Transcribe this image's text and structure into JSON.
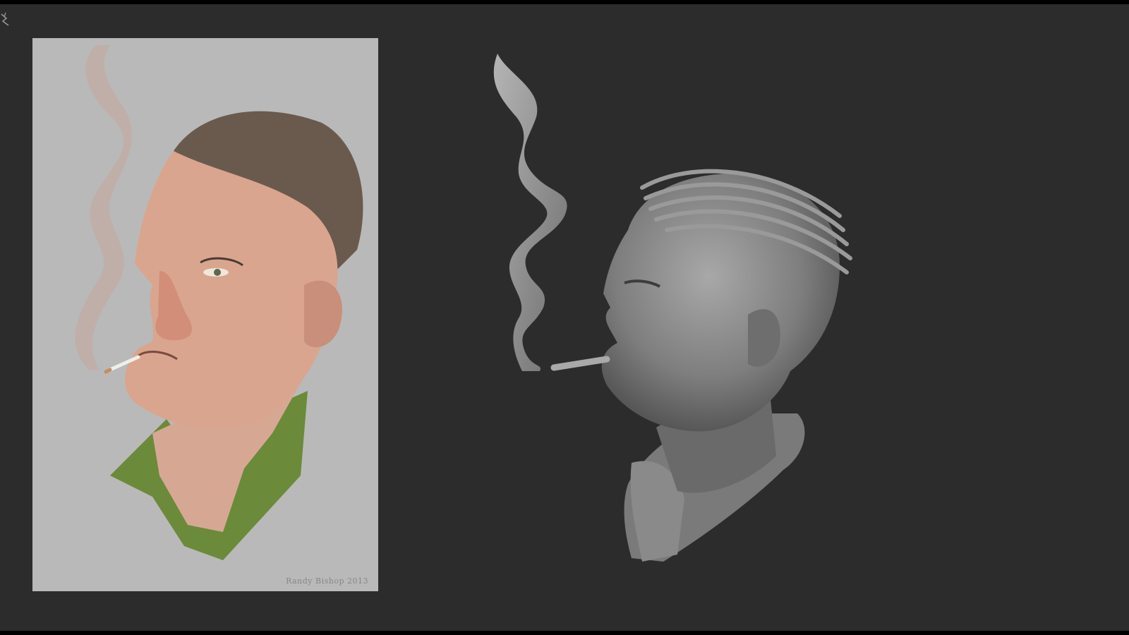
{
  "reference_image": {
    "signature": "Randy Bishop 2013",
    "background_color": "#b9b9b9",
    "shirt_color": "#6b8a3a",
    "skin_color": "#d9a58e",
    "hair_color": "#6a5a4e"
  },
  "viewport": {
    "background_color": "#2c2c2c",
    "sculpt_color": "#8e8e8e"
  },
  "icons": {
    "corner": "app-logo-icon"
  }
}
